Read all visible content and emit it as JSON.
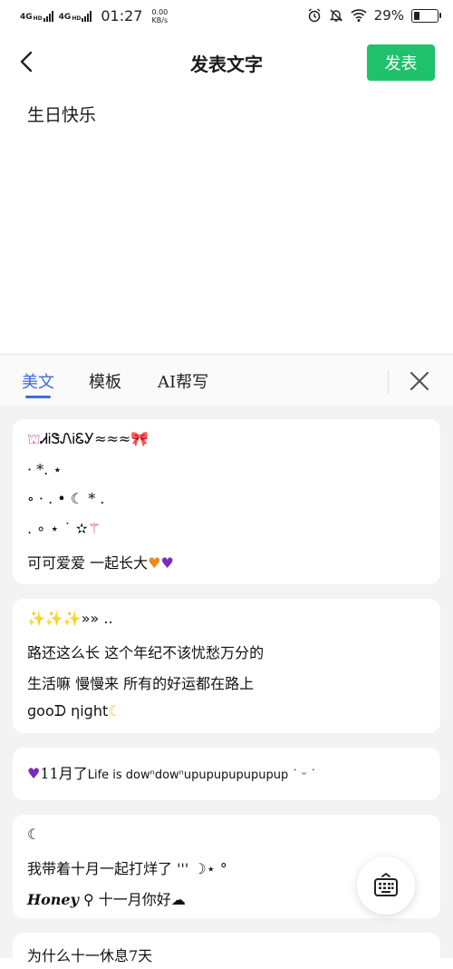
{
  "status_bar": {
    "network1": "4G",
    "network1_sup": "HD",
    "network2": "4G",
    "network2_sup": "HD",
    "time": "01:27",
    "speed_value": "0.00",
    "speed_unit": "KB/s",
    "battery_percent": "29%",
    "battery_level": 0.29
  },
  "header": {
    "title": "发表文字",
    "publish_label": "发表"
  },
  "editor": {
    "text": "生日快乐"
  },
  "tabs": [
    {
      "label": "美文",
      "active": true
    },
    {
      "label": "模板",
      "active": false
    },
    {
      "label": "AI帮写",
      "active": false
    }
  ],
  "cards": [
    {
      "lines": [
        "ᏗᎥᏕᏁᎥᏋᎩ≈≈≈",
        "·    *.  ⋆",
        " ∘  · .  • ☾ *   .",
        ". ∘    ⋆  ˙ ✫",
        "可可爱爱 一起长大"
      ]
    },
    {
      "lines": [
        "»» ..",
        "路还这么长 这个年纪不该忧愁万分的",
        "生活嘛 慢慢来 所有的好运都在路上",
        "ɡooᗪ ηiɡht"
      ]
    },
    {
      "lines": [
        "11月了",
        "Life is dowⁿdowⁿupupupupupupup  ˙ ᵕ ˙"
      ]
    },
    {
      "lines": [
        "☾",
        "我带着十月一起打烊了 ''' ☽⋆ °",
        "Honey",
        "十一月你好"
      ]
    },
    {
      "lines": [
        "为什么十一休息7天"
      ]
    }
  ]
}
